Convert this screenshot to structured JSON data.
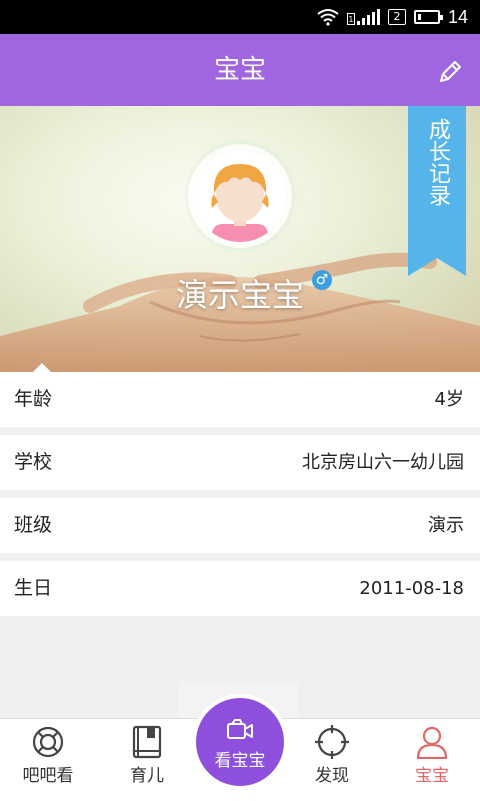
{
  "status_bar": {
    "sim1": "1",
    "sim2": "2",
    "time": "14"
  },
  "header": {
    "title": "宝宝",
    "edit_icon": "pencil-icon"
  },
  "hero": {
    "baby_name": "演示宝宝",
    "gender_symbol": "♂",
    "growth_record_label": "成长记录"
  },
  "info": [
    {
      "label": "年龄",
      "value": "4岁"
    },
    {
      "label": "学校",
      "value": "北京房山六一幼儿园"
    },
    {
      "label": "班级",
      "value": "演示"
    },
    {
      "label": "生日",
      "value": "2011-08-18"
    }
  ],
  "tabbar": {
    "tabs": [
      {
        "label": "吧吧看",
        "icon": "lifebuoy-icon"
      },
      {
        "label": "育儿",
        "icon": "book-icon"
      },
      {
        "label": "看宝宝",
        "icon": "video-camera-icon"
      },
      {
        "label": "发现",
        "icon": "crosshair-icon"
      },
      {
        "label": "宝宝",
        "icon": "person-icon"
      }
    ],
    "active_index": 4
  },
  "colors": {
    "header": "#a066e0",
    "center_button": "#8e4fdc",
    "ribbon": "#55b4ea",
    "active_tab": "#e06868"
  }
}
